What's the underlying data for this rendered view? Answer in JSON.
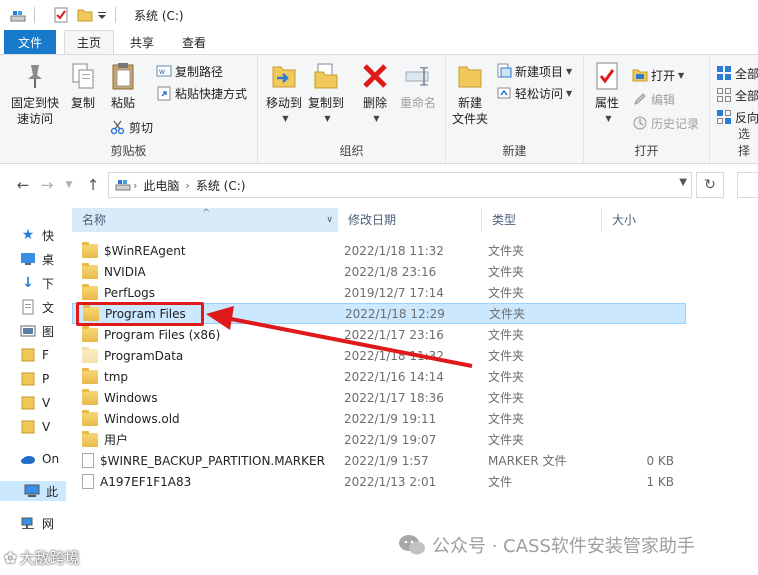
{
  "window": {
    "title": "系统 (C:)"
  },
  "tabs": [
    {
      "label": "文件"
    },
    {
      "label": "主页"
    },
    {
      "label": "共享"
    },
    {
      "label": "查看"
    }
  ],
  "ribbon": {
    "clipboard": {
      "group_label": "剪贴板",
      "pin_label_1": "固定到快",
      "pin_label_2": "速访问",
      "copy_label": "复制",
      "paste_label": "粘贴",
      "copy_path_label": "复制路径",
      "paste_shortcut_label": "粘贴快捷方式",
      "cut_label": "剪切"
    },
    "organize": {
      "group_label": "组织",
      "move_to_label": "移动到",
      "copy_to_label": "复制到",
      "delete_label": "删除",
      "rename_label": "重命名"
    },
    "new": {
      "group_label": "新建",
      "new_folder_label_1": "新建",
      "new_folder_label_2": "文件夹",
      "new_item_label": "新建项目",
      "easy_access_label": "轻松访问"
    },
    "open": {
      "group_label": "打开",
      "properties_label": "属性",
      "open_label": "打开",
      "edit_label": "编辑",
      "history_label": "历史记录"
    },
    "select": {
      "group_label": "选择",
      "select_all_label": "全部",
      "select_none_label": "全部",
      "invert_label": "反向"
    }
  },
  "address": {
    "crumbs": [
      "此电脑",
      "系统 (C:)"
    ]
  },
  "navpane": {
    "items": [
      {
        "label": "快"
      },
      {
        "label": "桌"
      },
      {
        "label": "下"
      },
      {
        "label": "文"
      },
      {
        "label": "图"
      },
      {
        "label": "F"
      },
      {
        "label": "P"
      },
      {
        "label": "V"
      },
      {
        "label": "V"
      },
      {
        "label": "On"
      },
      {
        "label": "此"
      },
      {
        "label": "网"
      }
    ]
  },
  "columns": {
    "name": "名称",
    "date": "修改日期",
    "type": "类型",
    "size": "大小"
  },
  "files": [
    {
      "name": "$WinREAgent",
      "date": "2022/1/18 11:32",
      "type": "文件夹",
      "size": ""
    },
    {
      "name": "NVIDIA",
      "date": "2022/1/8 23:16",
      "type": "文件夹",
      "size": ""
    },
    {
      "name": "PerfLogs",
      "date": "2019/12/7 17:14",
      "type": "文件夹",
      "size": ""
    },
    {
      "name": "Program Files",
      "date": "2022/1/18 12:29",
      "type": "文件夹",
      "size": ""
    },
    {
      "name": "Program Files (x86)",
      "date": "2022/1/17 23:16",
      "type": "文件夹",
      "size": ""
    },
    {
      "name": "ProgramData",
      "date": "2022/1/18 11:32",
      "type": "文件夹",
      "size": ""
    },
    {
      "name": "tmp",
      "date": "2022/1/16 14:14",
      "type": "文件夹",
      "size": ""
    },
    {
      "name": "Windows",
      "date": "2022/1/17 18:36",
      "type": "文件夹",
      "size": ""
    },
    {
      "name": "Windows.old",
      "date": "2022/1/9 19:11",
      "type": "文件夹",
      "size": ""
    },
    {
      "name": "用户",
      "date": "2022/1/9 19:07",
      "type": "文件夹",
      "size": ""
    },
    {
      "name": "$WINRE_BACKUP_PARTITION.MARKER",
      "date": "2022/1/9 1:57",
      "type": "MARKER 文件",
      "size": "0 KB"
    },
    {
      "name": "A197EF1F1A83",
      "date": "2022/1/13 2:01",
      "type": "文件",
      "size": "1 KB"
    }
  ],
  "watermark": {
    "left_text": "大敌跨境",
    "right_text": "公众号 · CASS软件安装管家助手"
  }
}
